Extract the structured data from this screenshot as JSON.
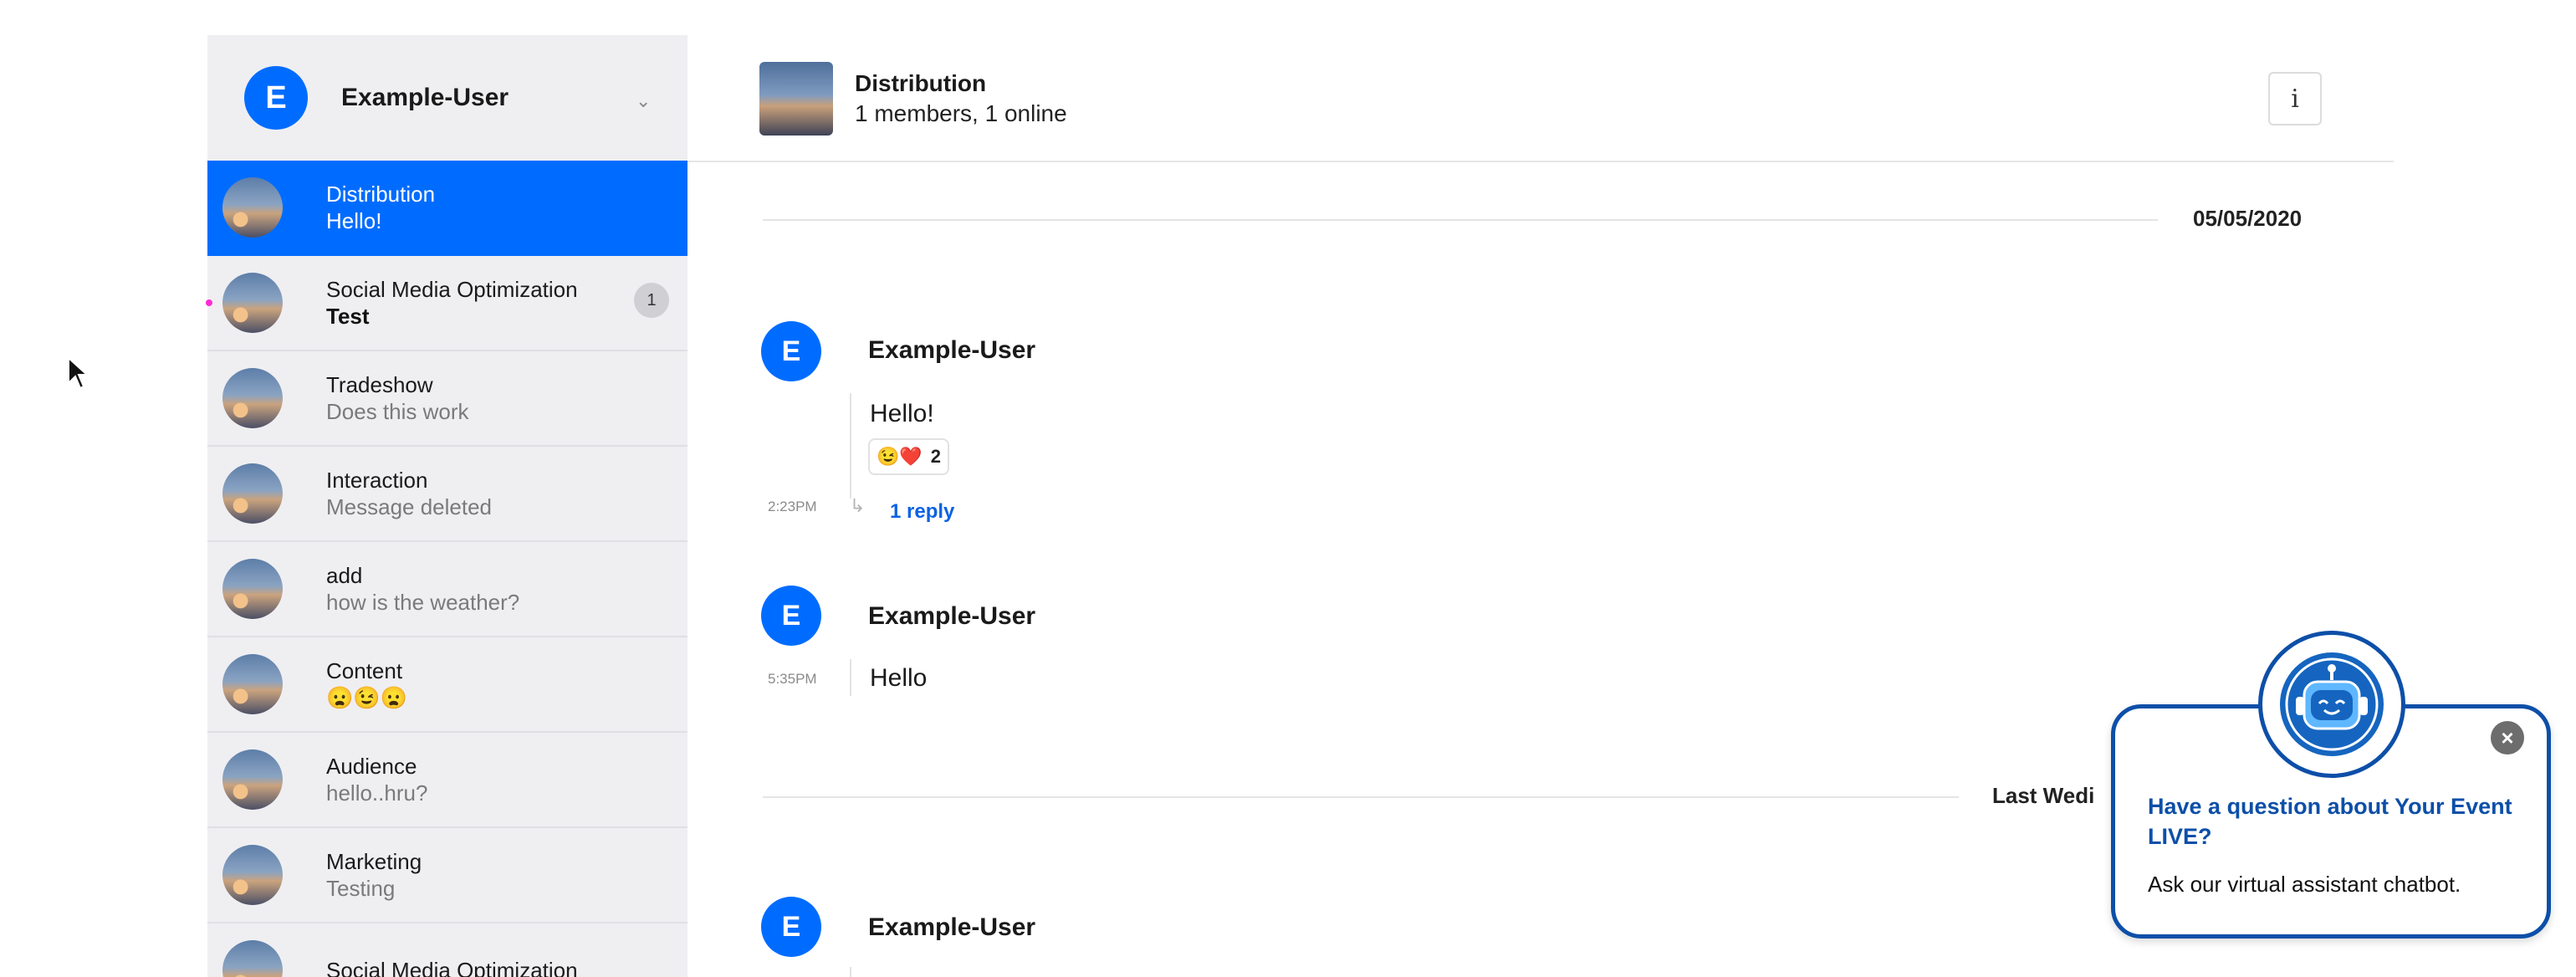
{
  "sidebar": {
    "user": {
      "initial": "E",
      "name": "Example-User"
    },
    "channels": [
      {
        "name": "Distribution",
        "preview": "Hello!",
        "active": true
      },
      {
        "name": "Social Media Optimization",
        "preview": "Test",
        "unread": "1"
      },
      {
        "name": "Tradeshow",
        "preview": "Does this work"
      },
      {
        "name": "Interaction",
        "preview": "Message deleted"
      },
      {
        "name": "add",
        "preview": "how is the weather?"
      },
      {
        "name": "Content",
        "preview": "😦😉😦"
      },
      {
        "name": "Audience",
        "preview": "hello..hru?"
      },
      {
        "name": "Marketing",
        "preview": "Testing"
      },
      {
        "name": "Social Media Optimization",
        "preview": ""
      }
    ]
  },
  "chat": {
    "title": "Distribution",
    "subtitle": "1 members, 1 online",
    "info_label": "i",
    "date_separators": [
      "05/05/2020",
      "Last Wedi"
    ],
    "messages": [
      {
        "initial": "E",
        "author": "Example-User",
        "text": "Hello!",
        "time": "2:23PM",
        "reactions": "😉❤️",
        "reaction_count": "2",
        "reply": "1 reply"
      },
      {
        "initial": "E",
        "author": "Example-User",
        "text": "Hello",
        "time": "5:35PM"
      },
      {
        "initial": "E",
        "author": "Example-User"
      }
    ]
  },
  "chatbot": {
    "title": "Have a question about Your Event LIVE?",
    "subtitle": "Ask our virtual assistant chatbot.",
    "close": "×",
    "icon": "robot-icon"
  },
  "colors": {
    "accent": "#006cff",
    "bot_border": "#0d4fa8",
    "link": "#0b62e3"
  }
}
